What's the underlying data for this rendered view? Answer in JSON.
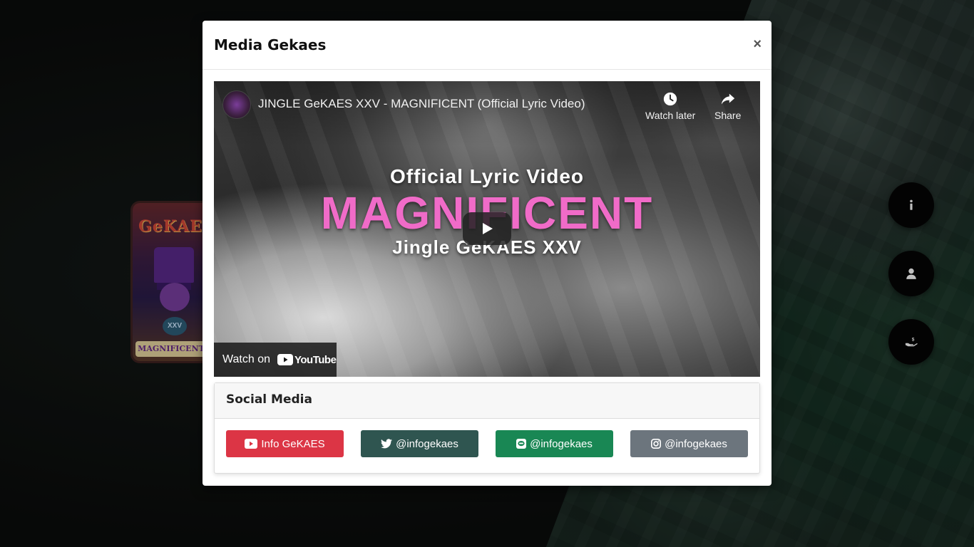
{
  "modal": {
    "title": "Media Gekaes",
    "close_label": "×"
  },
  "video": {
    "title": "JINGLE GeKAES XXV - MAGNIFICENT (Official Lyric Video)",
    "watch_later_label": "Watch later",
    "share_label": "Share",
    "watch_on_label": "Watch on",
    "youtube_logo_text": "YouTube",
    "lyric_line_1": "Official Lyric Video",
    "lyric_line_2": "MAGNIFICENT",
    "lyric_line_3": "Jingle GeKAES XXV"
  },
  "poster": {
    "title": "GeKAES",
    "badge": "XXV",
    "banner": "MAGNIFICENT"
  },
  "social": {
    "title": "Social Media",
    "buttons": [
      {
        "label": "Info GeKAES",
        "icon": "youtube-icon",
        "color": "#dc3545"
      },
      {
        "label": "@infogekaes",
        "icon": "twitter-icon",
        "color": "#2f5550"
      },
      {
        "label": "@infogekaes",
        "icon": "line-icon",
        "color": "#198754"
      },
      {
        "label": "@infogekaes",
        "icon": "instagram-icon",
        "color": "#6c757d"
      }
    ]
  },
  "side_buttons": [
    {
      "icon": "info-icon"
    },
    {
      "icon": "user-icon"
    },
    {
      "icon": "donate-hand-icon"
    }
  ]
}
